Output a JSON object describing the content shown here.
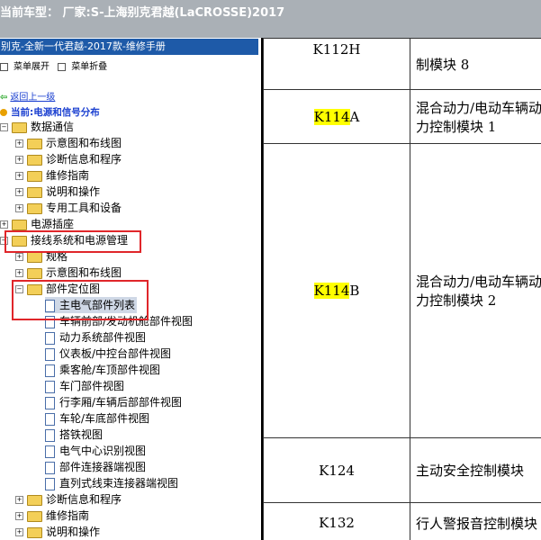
{
  "titlebar": {
    "text": "当前车型：  厂家:S-上海别克君越(LaCROSSE)2017"
  },
  "manual": {
    "title": "别克-全新一代君越-2017款-维修手册"
  },
  "toolbar": {
    "expand": "菜单展开",
    "collapse": "菜单折叠"
  },
  "back_link": "返回上一级",
  "current": "当前:电源和信号分布",
  "tree": [
    {
      "label": "数据通信"
    },
    {
      "label": "示意图和布线图"
    },
    {
      "label": "诊断信息和程序"
    },
    {
      "label": "维修指南"
    },
    {
      "label": "说明和操作"
    },
    {
      "label": "专用工具和设备"
    },
    {
      "label": "电源插座"
    },
    {
      "label": "接线系统和电源管理"
    },
    {
      "label": "规格"
    },
    {
      "label": "示意图和布线图"
    },
    {
      "label": "部件定位图"
    },
    {
      "label": "主电气部件列表"
    },
    {
      "label": "车辆前部/发动机舱部件视图"
    },
    {
      "label": "动力系统部件视图"
    },
    {
      "label": "仪表板/中控台部件视图"
    },
    {
      "label": "乘客舱/车顶部件视图"
    },
    {
      "label": "车门部件视图"
    },
    {
      "label": "行李厢/车辆后部部件视图"
    },
    {
      "label": "车轮/车底部件视图"
    },
    {
      "label": "搭铁视图"
    },
    {
      "label": "电气中心识别视图"
    },
    {
      "label": "部件连接器端视图"
    },
    {
      "label": "直列式线束连接器端视图"
    },
    {
      "label": "诊断信息和程序"
    },
    {
      "label": "维修指南"
    },
    {
      "label": "说明和操作"
    }
  ],
  "table": {
    "rows": [
      {
        "code_hl": "",
        "code_rest": "K112H",
        "name": "制模块 8"
      },
      {
        "code_hl": "K114",
        "code_rest": "A",
        "name": "混合动力/电动车辆动力控制模块 1"
      },
      {
        "code_hl": "K114",
        "code_rest": "B",
        "name": "混合动力/电动车辆动力控制模块 2"
      },
      {
        "code_hl": "",
        "code_rest": "K124",
        "name": "主动安全控制模块"
      },
      {
        "code_hl": "",
        "code_rest": "K132",
        "name": "行人警报音控制模块"
      }
    ]
  },
  "colors": {
    "manual_bar": "#1e5aa8",
    "highlight_box": "#e0262a",
    "search_highlight": "#ffff00"
  }
}
